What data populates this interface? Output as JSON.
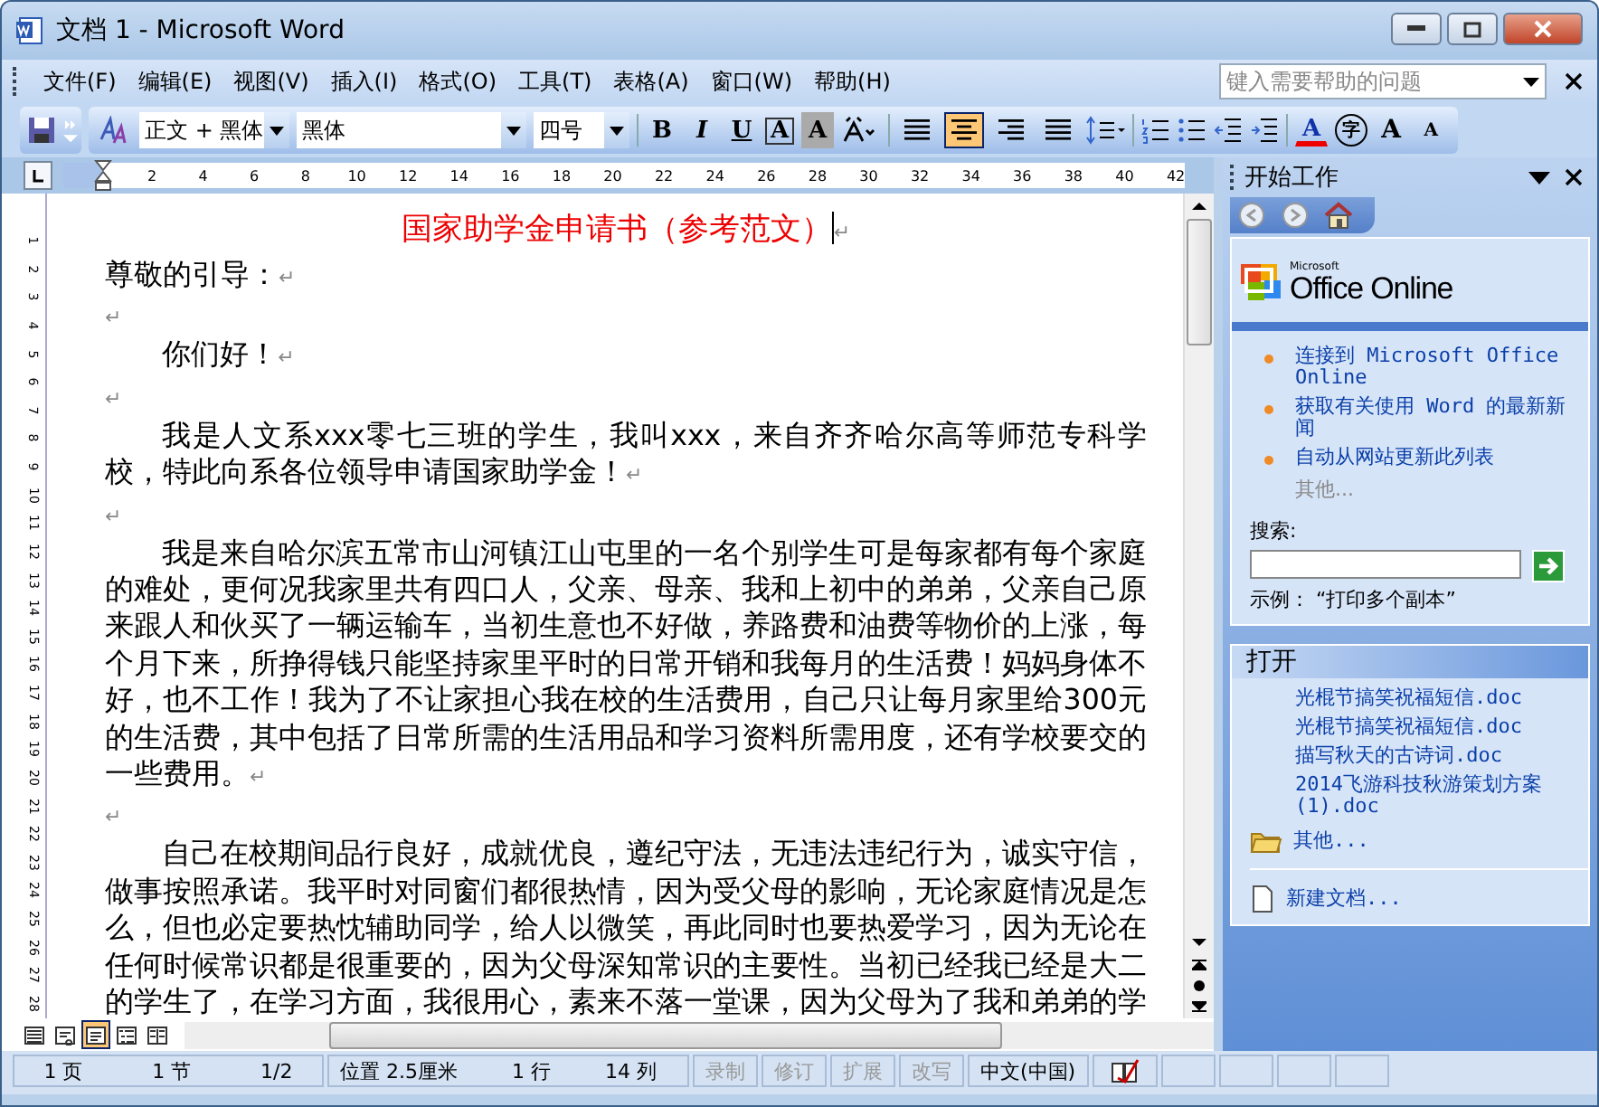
{
  "window": {
    "title": "文档 1 - Microsoft Word"
  },
  "menu": [
    {
      "label": "文件(F)"
    },
    {
      "label": "编辑(E)"
    },
    {
      "label": "视图(V)"
    },
    {
      "label": "插入(I)"
    },
    {
      "label": "格式(O)"
    },
    {
      "label": "工具(T)"
    },
    {
      "label": "表格(A)"
    },
    {
      "label": "窗口(W)"
    },
    {
      "label": "帮助(H)"
    }
  ],
  "help_search": {
    "placeholder": "键入需要帮助的问题"
  },
  "toolbar": {
    "style": "正文 + 黑体",
    "font": "黑体",
    "size": "四号",
    "char_buttons": [
      {
        "kind": "bold",
        "label": "B"
      },
      {
        "kind": "italic",
        "label": "I"
      },
      {
        "kind": "underline",
        "label": "U"
      },
      {
        "kind": "border",
        "label": "A"
      },
      {
        "kind": "shading",
        "label": "A"
      }
    ],
    "align": [
      {
        "kind": "justify",
        "selected": false
      },
      {
        "kind": "center",
        "selected": true
      },
      {
        "kind": "right",
        "selected": false
      },
      {
        "kind": "distributed",
        "selected": false
      }
    ],
    "tail_buttons": [
      {
        "kind": "font-color",
        "label": "A"
      },
      {
        "kind": "phonetic",
        "label": "字"
      },
      {
        "kind": "grow",
        "label": "A"
      },
      {
        "kind": "shrink",
        "label": "A"
      }
    ]
  },
  "ruler": {
    "numbers": [
      "2",
      "4",
      "6",
      "8",
      "10",
      "12",
      "14",
      "16",
      "18",
      "20",
      "22",
      "24",
      "26",
      "28",
      "30",
      "32",
      "34",
      "36",
      "38",
      "40",
      "42"
    ],
    "vertical_numbers": [
      "1",
      "2",
      "3",
      "4",
      "5",
      "6",
      "7",
      "8",
      "9",
      "10",
      "11",
      "12",
      "13",
      "14",
      "15",
      "16",
      "17",
      "18",
      "19",
      "20",
      "21",
      "22",
      "23",
      "24",
      "25",
      "26",
      "27",
      "28"
    ]
  },
  "document": {
    "title": "国家助学金申请书（参考范文）",
    "title_mark": "↵",
    "paragraphs": [
      {
        "kind": "plain",
        "text": "尊敬的引导：",
        "end_mark": "↵"
      },
      {
        "kind": "blank",
        "end_mark": "↵"
      },
      {
        "kind": "indent",
        "text": "你们好！",
        "end_mark": "↵"
      },
      {
        "kind": "blank",
        "end_mark": "↵"
      },
      {
        "kind": "indent",
        "text": "我是人文系xxx零七三班的学生，我叫xxx，来自齐齐哈尔高等师范专科学校，特此向系各位领导申请国家助学金！",
        "end_mark": "↵"
      },
      {
        "kind": "blank",
        "end_mark": "↵"
      },
      {
        "kind": "indent",
        "text": "我是来自哈尔滨五常市山河镇江山屯里的一名个别学生可是每家都有每个家庭的难处，更何况我家里共有四口人，父亲、母亲、我和上初中的弟弟，父亲自己原来跟人和伙买了一辆运输车，当初生意也不好做，养路费和油费等物价的上涨，每个月下来，所挣得钱只能坚持家里平时的日常开销和我每月的生活费！妈妈身体不好，也不工作！我为了不让家担心我在校的生活费用，自己只让每月家里给300元的生活费，其中包括了日常所需的生活用品和学习资料所需用度，还有学校要交的一些费用。",
        "end_mark": "↵"
      },
      {
        "kind": "blank",
        "end_mark": "↵"
      },
      {
        "kind": "indent",
        "text": "自己在校期间品行良好，成就优良，遵纪守法，无违法违纪行为，诚实守信，做事按照承诺。我平时对同窗们都很热情，因为受父母的影响，无论家庭情况是怎么，但也必定要热忱辅助同学，给人以微笑，再此同时也要热爱学习，因为无论在任何时候常识都是很重要的，因为父母深知常识的主要性。当初已经我已经是大二的学生了，在学习方面，我很用心，素来不落一堂课，因为父母为了我和弟弟的学"
      }
    ]
  },
  "view_buttons": [
    {
      "kind": "normal",
      "selected": false
    },
    {
      "kind": "web",
      "selected": false
    },
    {
      "kind": "print",
      "selected": true
    },
    {
      "kind": "outline",
      "selected": false
    },
    {
      "kind": "reading",
      "selected": false
    }
  ],
  "task_pane": {
    "title": "开始工作",
    "brand": "Office Online",
    "brand_small": "Microsoft",
    "links": [
      {
        "label": "连接到 Microsoft Office Online"
      },
      {
        "label": "获取有关使用 Word 的最新新闻"
      },
      {
        "label": "自动从网站更新此列表"
      }
    ],
    "more": "其他...",
    "search_label": "搜索:",
    "example": "示例：  “打印多个副本”",
    "open_title": "打开",
    "files": [
      {
        "label": "光棍节搞笑祝福短信.doc"
      },
      {
        "label": "光棍节搞笑祝福短信.doc"
      },
      {
        "label": "描写秋天的古诗词.doc"
      },
      {
        "label": "2014飞游科技秋游策划方案(1).doc"
      }
    ],
    "open_more": "其他...",
    "new_doc": "新建文档..."
  },
  "status_bar": [
    {
      "text": "1 页",
      "disabled": false
    },
    {
      "text": "1 节",
      "disabled": false
    },
    {
      "text": "1/2",
      "disabled": false
    },
    {
      "text": "位置 2.5厘米",
      "disabled": false
    },
    {
      "text": "1 行",
      "disabled": false
    },
    {
      "text": "14 列",
      "disabled": false
    },
    {
      "text": "录制",
      "disabled": true
    },
    {
      "text": "修订",
      "disabled": true
    },
    {
      "text": "扩展",
      "disabled": true
    },
    {
      "text": "改写",
      "disabled": true
    },
    {
      "text": "中文(中国)",
      "disabled": false
    }
  ]
}
